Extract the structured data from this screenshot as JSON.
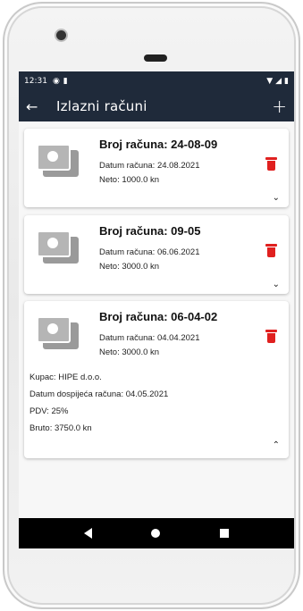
{
  "status": {
    "time": "12:31",
    "left_icons": [
      "p-icon",
      "sim-icon"
    ],
    "right_icons": [
      "wifi-icon",
      "signal-icon",
      "battery-icon"
    ]
  },
  "appbar": {
    "title": "Izlazni računi",
    "back_icon": "arrow-left-icon",
    "add_label": "+"
  },
  "invoices": [
    {
      "number_label": "Broj računa: 24-08-09",
      "date_label": "Datum računa: 24.08.2021",
      "net_label": "Neto: 1000.0 kn",
      "expanded": false
    },
    {
      "number_label": "Broj računa: 09-05",
      "date_label": "Datum računa: 06.06.2021",
      "net_label": "Neto: 3000.0 kn",
      "expanded": false
    },
    {
      "number_label": "Broj računa: 06-04-02",
      "date_label": "Datum računa: 04.04.2021",
      "net_label": "Neto: 3000.0 kn",
      "expanded": true,
      "details": {
        "buyer": "Kupac: HIPE d.o.o.",
        "due_date": "Datum dospijeća računa: 04.05.2021",
        "vat": "PDV: 25%",
        "gross": "Bruto: 3750.0 kn"
      }
    }
  ],
  "colors": {
    "appbar": "#1f2a3a",
    "delete": "#e0201f",
    "thumbnail": "#b5b5b5"
  }
}
